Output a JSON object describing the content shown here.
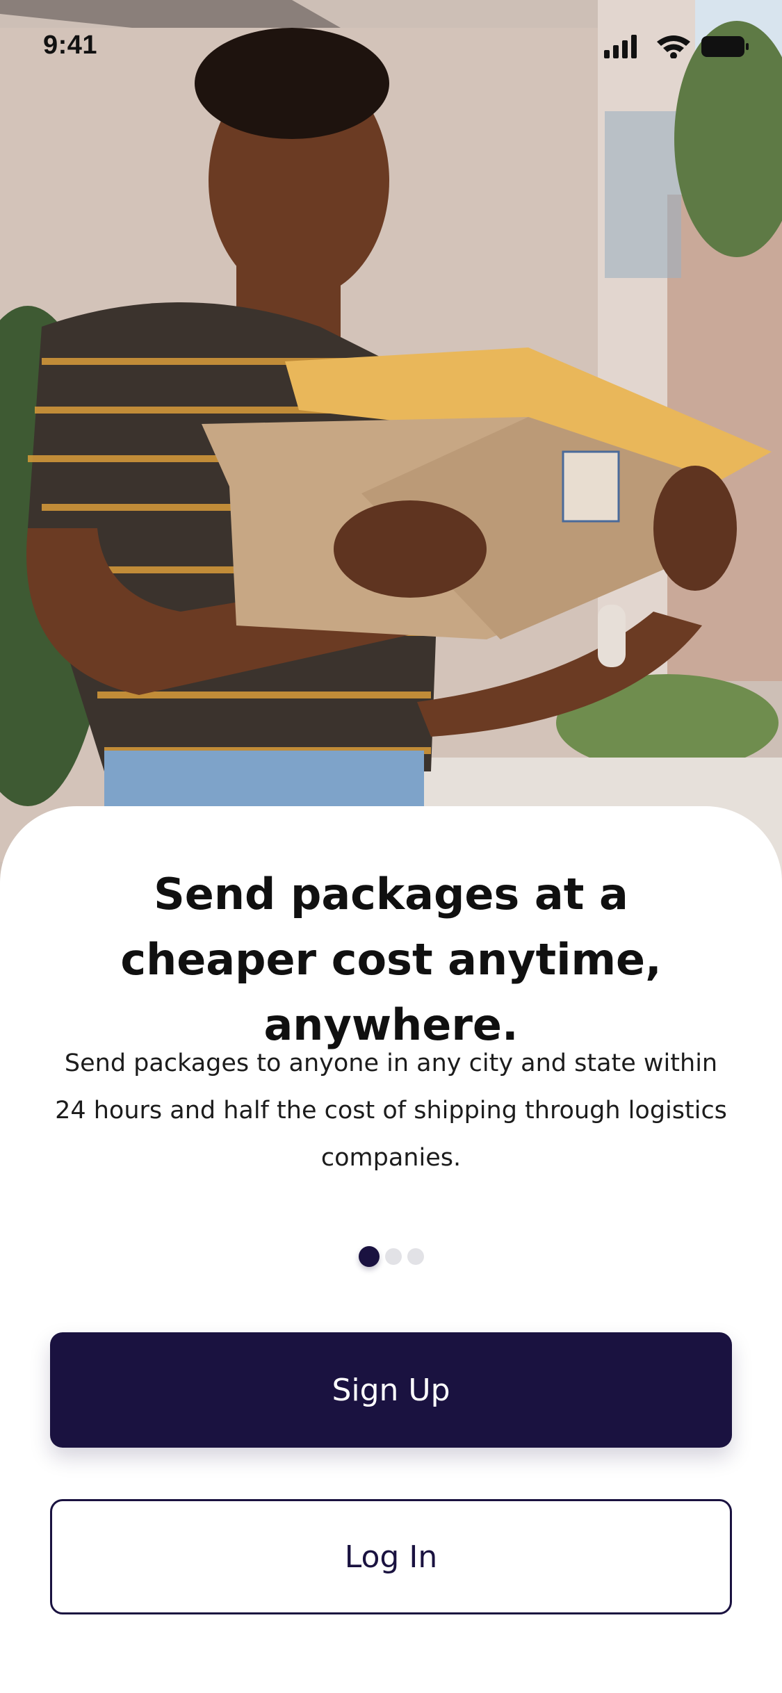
{
  "status_bar": {
    "time": "9:41",
    "icons": [
      "cellular-signal-icon",
      "wifi-icon",
      "battery-icon"
    ]
  },
  "hero": {
    "image": "photo-woman-holding-packages"
  },
  "onboarding": {
    "headline": "Send packages at a cheaper cost anytime, anywhere.",
    "description": "Send packages to anyone in any city and state within 24 hours and half the cost of shipping through logistics companies.",
    "pager": {
      "total": 3,
      "current": 1
    }
  },
  "actions": {
    "signup_label": "Sign Up",
    "login_label": "Log In"
  },
  "colors": {
    "primary": "#1a1240",
    "dot_inactive": "#e2e2e6",
    "text": "#101010",
    "background": "#ffffff"
  }
}
